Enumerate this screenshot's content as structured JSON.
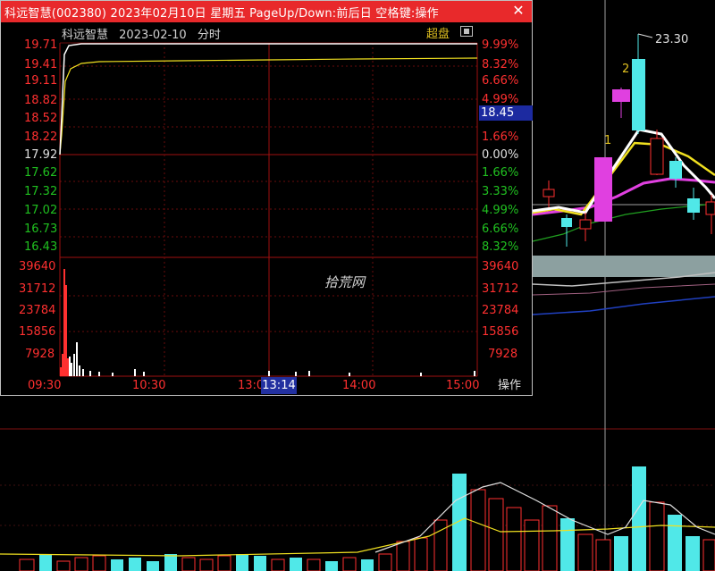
{
  "window": {
    "title": "科远智慧(002380) 2023年02月10日 星期五 PageUp/Down:前后日 空格键:操作",
    "close_label": "✕",
    "chart_name": "科远智慧",
    "chart_date": "2023-02-10",
    "chart_mode": "分时",
    "super_label": "超盘",
    "watermark": "拾荒网",
    "ops_label": "操作",
    "current_price": "18.45",
    "cursor_time": "13:14"
  },
  "price_axis": {
    "left_red": [
      "19.71",
      "19.41",
      "19.11",
      "18.82",
      "18.52",
      "18.22"
    ],
    "left_mid": "17.92",
    "left_green": [
      "17.62",
      "17.32",
      "17.02",
      "16.73",
      "16.43"
    ],
    "right_red": [
      "9.99%",
      "8.32%",
      "6.66%",
      "4.99%",
      "1.66%"
    ],
    "right_mid": "0.00%",
    "right_green": [
      "1.66%",
      "3.33%",
      "4.99%",
      "6.66%",
      "8.32%"
    ]
  },
  "volume_axis": {
    "labels": [
      "39640",
      "31712",
      "23784",
      "15856",
      "7928"
    ]
  },
  "time_axis": [
    "09:30",
    "10:30",
    "13:00",
    "14:00",
    "15:00"
  ],
  "kline": {
    "high_label": "23.30",
    "marks": [
      "1",
      "2"
    ]
  },
  "colors": {
    "title_bar": "#e8292b",
    "up": "#ff3030",
    "down": "#50e8e8",
    "ma_yellow": "#f0e020",
    "ma_magenta": "#e040e0",
    "ma_white": "#ffffff",
    "ma_green": "#20a020"
  },
  "icons": [
    "close-icon",
    "toggle-icon"
  ]
}
